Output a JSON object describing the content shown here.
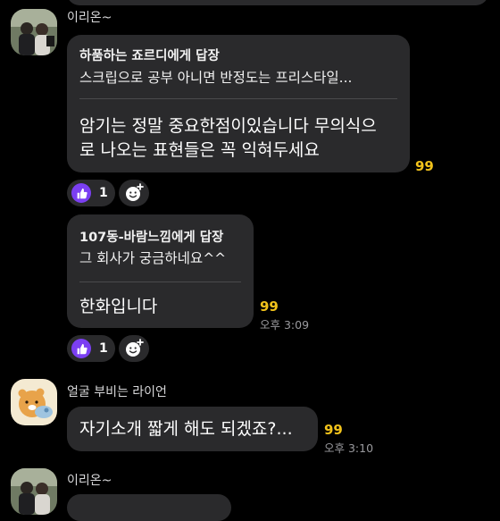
{
  "messages": [
    {
      "sender": "이리온~",
      "reply_header": "하품하는 죠르디에게 답장",
      "reply_quote": "스크립으로 공부 아니면 반정도는 프리스타일...",
      "text_line1": "암기는 정말 중요한점이있습니다 무의식으",
      "text_line2": "로 나오는 표현들은 꼭 익혀두세요",
      "unread": "99",
      "reaction_count": "1"
    },
    {
      "reply_header": "107동-바람느낌에게 답장",
      "reply_quote": "그 회사가 궁금하네요^^",
      "text": "한화입니다",
      "unread": "99",
      "time": "오후 3:09",
      "reaction_count": "1"
    },
    {
      "sender": "얼굴 부비는 라이언",
      "text": "자기소개 짧게 해도 되겠죠?...",
      "unread": "99",
      "time": "오후 3:10"
    },
    {
      "sender": "이리온~"
    }
  ],
  "colors": {
    "background": "#000000",
    "bubble": "#2a2a2c",
    "unread": "#f1c21b",
    "reaction": "#7b3ff2"
  },
  "icons": [
    "thumbs-up-icon",
    "add-reaction-icon"
  ]
}
